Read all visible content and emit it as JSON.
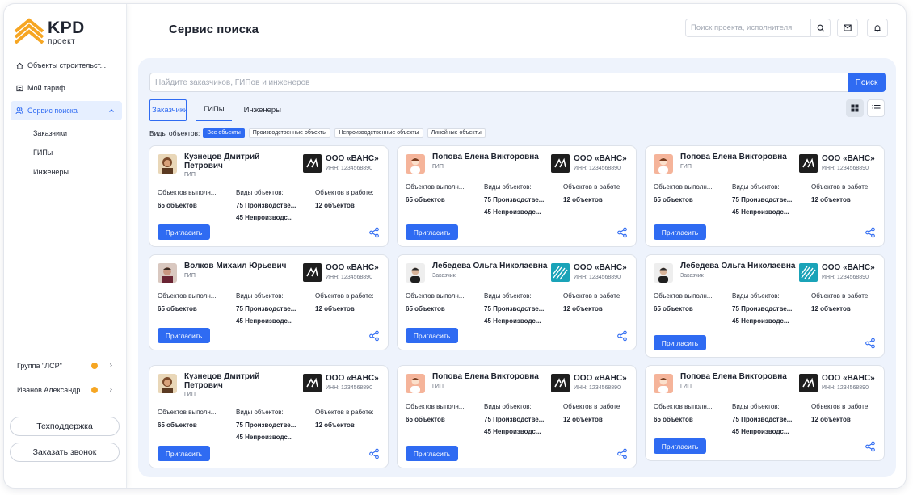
{
  "brand": {
    "name": "KPD",
    "sub": "проект"
  },
  "sidebar": {
    "items": [
      {
        "label": "Объекты строительст..."
      },
      {
        "label": "Мой тариф"
      },
      {
        "label": "Сервис поиска"
      }
    ],
    "sub_items": [
      "Заказчики",
      "ГИПы",
      "Инженеры"
    ],
    "orgs": [
      {
        "label": "Группа \"ЛСР\""
      },
      {
        "label": "Иванов Александр"
      }
    ],
    "support_label": "Техподдержка",
    "callback_label": "Заказать звонок"
  },
  "header": {
    "title": "Сервис поиска",
    "search_placeholder": "Поиск проекта, исполнителя"
  },
  "main": {
    "search_placeholder": "Найдите заказчиков, ГИПов и инженеров",
    "search_button": "Поиск",
    "tabs": [
      {
        "label": "Заказчики"
      },
      {
        "label": "ГИПы"
      },
      {
        "label": "Инженеры"
      }
    ],
    "filters_label": "Виды объектов:",
    "filters": [
      {
        "label": "Все объекты"
      },
      {
        "label": "Производственные объекты"
      },
      {
        "label": "Непроизводственные объекты"
      },
      {
        "label": "Линейные объекты"
      }
    ]
  },
  "common": {
    "invite": "Пригласить",
    "done_label": "Объектов выполн...",
    "kinds_label": "Виды объектов:",
    "work_label": "Объектов в работе:"
  },
  "cards": [
    {
      "name": "Кузнецов Дмитрий Петрович",
      "role": "ГИП",
      "company": "ООО «ВАНС»",
      "inn": "ИНН: 1234568890",
      "done": "65 объектов",
      "kind1": "75 Производстве...",
      "kind2": "45 Непроизводс...",
      "work": "12 объектов"
    },
    {
      "name": "Попова Елена Викторовна",
      "role": "ГИП",
      "company": "ООО «ВАНС»",
      "inn": "ИНН: 1234568890",
      "done": "65 объектов",
      "kind1": "75 Производстве...",
      "kind2": "45 Непроизводс...",
      "work": "12 объектов"
    },
    {
      "name": "Попова Елена Викторовна",
      "role": "ГИП",
      "company": "ООО «ВАНС»",
      "inn": "ИНН: 1234568890",
      "done": "65 объектов",
      "kind1": "75 Производстве...",
      "kind2": "45 Непроизводс...",
      "work": "12 объектов"
    },
    {
      "name": "Волков Михаил Юрьевич",
      "role": "ГИП",
      "company": "ООО «ВАНС»",
      "inn": "ИНН: 1234568890",
      "done": "65 объектов",
      "kind1": "75 Производстве...",
      "kind2": "45 Непроизводс...",
      "work": "12 объектов"
    },
    {
      "name": "Лебедева Ольга Николаевна",
      "role": "Заказчик",
      "company": "ООО «ВАНС»",
      "inn": "ИНН: 1234568890",
      "done": "65 объектов",
      "kind1": "75 Производстве...",
      "kind2": "45 Непроизводс...",
      "work": "12 объектов"
    },
    {
      "name": "Лебедева Ольга Николаевна",
      "role": "Заказчик",
      "company": "ООО «ВАНС»",
      "inn": "ИНН: 1234568890",
      "done": "65 объектов",
      "kind1": "75 Производстве...",
      "kind2": "45 Непроизводс...",
      "work": "12 объектов"
    },
    {
      "name": "Кузнецов Дмитрий Петрович",
      "role": "ГИП",
      "company": "ООО «ВАНС»",
      "inn": "ИНН: 1234568890",
      "done": "65 объектов",
      "kind1": "75 Производстве...",
      "kind2": "45 Непроизводс...",
      "work": "12 объектов"
    },
    {
      "name": "Попова Елена Викторовна",
      "role": "ГИП",
      "company": "ООО «ВАНС»",
      "inn": "ИНН: 1234568890",
      "done": "65 объектов",
      "kind1": "75 Производстве...",
      "kind2": "45 Непроизводс...",
      "work": "12 объектов"
    },
    {
      "name": "Попова Елена Викторовна",
      "role": "ГИП",
      "company": "ООО «ВАНС»",
      "inn": "ИНН: 1234568890",
      "done": "65 объектов",
      "kind1": "75 Производстве...",
      "kind2": "45 Непроизводс...",
      "work": "12 объектов"
    }
  ]
}
